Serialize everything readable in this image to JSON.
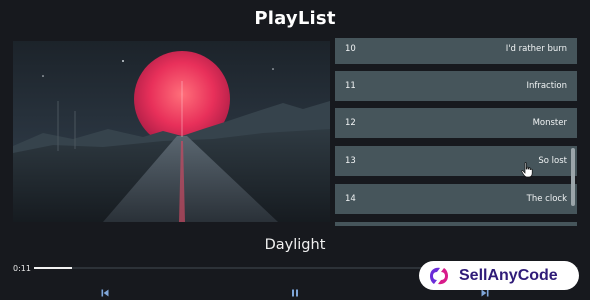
{
  "app": {
    "title": "PlayList"
  },
  "artwork": {
    "description": "sunset-road-artwork"
  },
  "playlist": {
    "tracks": [
      {
        "number": "10",
        "title": "I'd rather burn"
      },
      {
        "number": "11",
        "title": "Infraction"
      },
      {
        "number": "12",
        "title": "Monster"
      },
      {
        "number": "13",
        "title": "So lost"
      },
      {
        "number": "14",
        "title": "The clock"
      }
    ]
  },
  "player": {
    "now_playing": "Daylight",
    "elapsed": "0:11",
    "progress_fraction": 0.07
  },
  "controls": {
    "previous_icon": "skip-previous-icon",
    "pause_icon": "pause-icon",
    "next_icon": "skip-next-icon"
  },
  "watermark": {
    "text": "SellAnyCode",
    "color": "#2f1b78"
  },
  "colors": {
    "background": "#17191e",
    "track_bg": "#46555b",
    "control_icon": "#7fa6d9"
  }
}
